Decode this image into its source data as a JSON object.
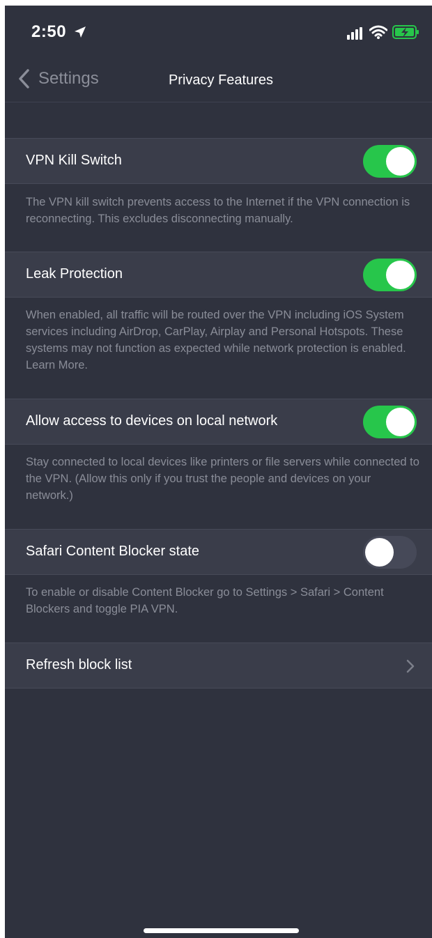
{
  "status_bar": {
    "time": "2:50",
    "icons": [
      "location-arrow-icon",
      "cellular-signal-icon",
      "wifi-icon",
      "battery-charging-icon"
    ],
    "battery_color": "#27c64b"
  },
  "nav": {
    "back_label": "Settings",
    "title": "Privacy Features"
  },
  "settings": [
    {
      "label": "VPN Kill Switch",
      "toggle": true,
      "description": "The VPN kill switch prevents access to the Internet if the VPN connection is reconnecting. This excludes disconnecting manually."
    },
    {
      "label": "Leak Protection",
      "toggle": true,
      "description": "When enabled, all traffic will be routed over the VPN including iOS System services including AirDrop, CarPlay, Airplay and Personal Hotspots. These systems may not function as expected while network protection is enabled. Learn More."
    },
    {
      "label": "Allow access to devices on local network",
      "toggle": true,
      "description": "Stay connected to local devices like printers or file servers while connected to the VPN. (Allow this only if you trust the people and devices on your network.)"
    },
    {
      "label": "Safari Content Blocker state",
      "toggle": false,
      "description": "To enable or disable Content Blocker go to Settings > Safari > Content Blockers and toggle PIA VPN."
    }
  ],
  "refresh": {
    "label": "Refresh block list"
  },
  "colors": {
    "background": "#2f323e",
    "row": "#3a3d4a",
    "toggle_on": "#27c64b",
    "toggle_off": "#464958"
  }
}
